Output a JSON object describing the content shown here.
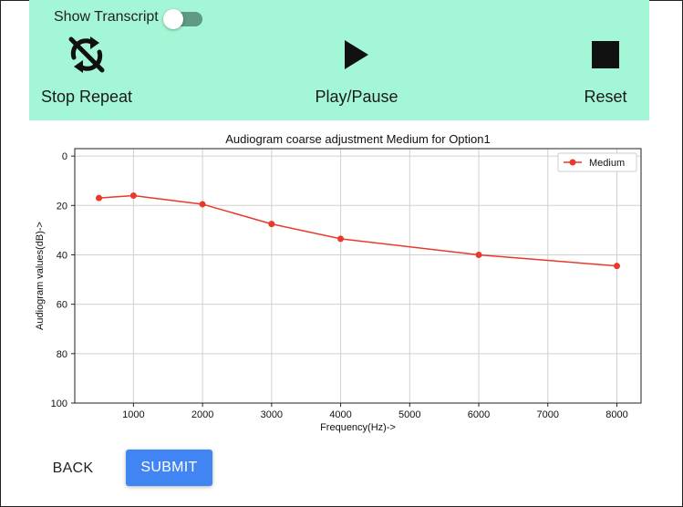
{
  "panel": {
    "transcript_label": "Show Transcript",
    "transcript_toggle_on": false,
    "controls": {
      "stop_repeat": {
        "label": "Stop Repeat",
        "icon": "repeat-off-icon"
      },
      "play_pause": {
        "label": "Play/Pause",
        "icon": "play-icon"
      },
      "reset": {
        "label": "Reset",
        "icon": "stop-square-icon"
      }
    },
    "background_color": "#a4f7d6"
  },
  "chart_data": {
    "type": "line",
    "title": "Audiogram coarse adjustment Medium for Option1",
    "xlabel": "Frequency(Hz)->",
    "ylabel": "Audiogram values(dB)->",
    "x": [
      500,
      1000,
      2000,
      3000,
      4000,
      6000,
      8000
    ],
    "series": [
      {
        "name": "Medium",
        "color": "#e8392b",
        "values": [
          17,
          16,
          19.5,
          27.5,
          33.5,
          40,
          44.5
        ]
      }
    ],
    "xlim": [
      150,
      8350
    ],
    "ylim": [
      100,
      -3
    ],
    "y_inverted": true,
    "x_ticks": [
      1000,
      2000,
      3000,
      4000,
      5000,
      6000,
      7000,
      8000
    ],
    "y_ticks": [
      0,
      20,
      40,
      60,
      80,
      100
    ],
    "grid": true,
    "legend_position": "top-right"
  },
  "footer": {
    "back_label": "BACK",
    "submit_label": "SUBMIT",
    "submit_color": "#4185f4"
  }
}
